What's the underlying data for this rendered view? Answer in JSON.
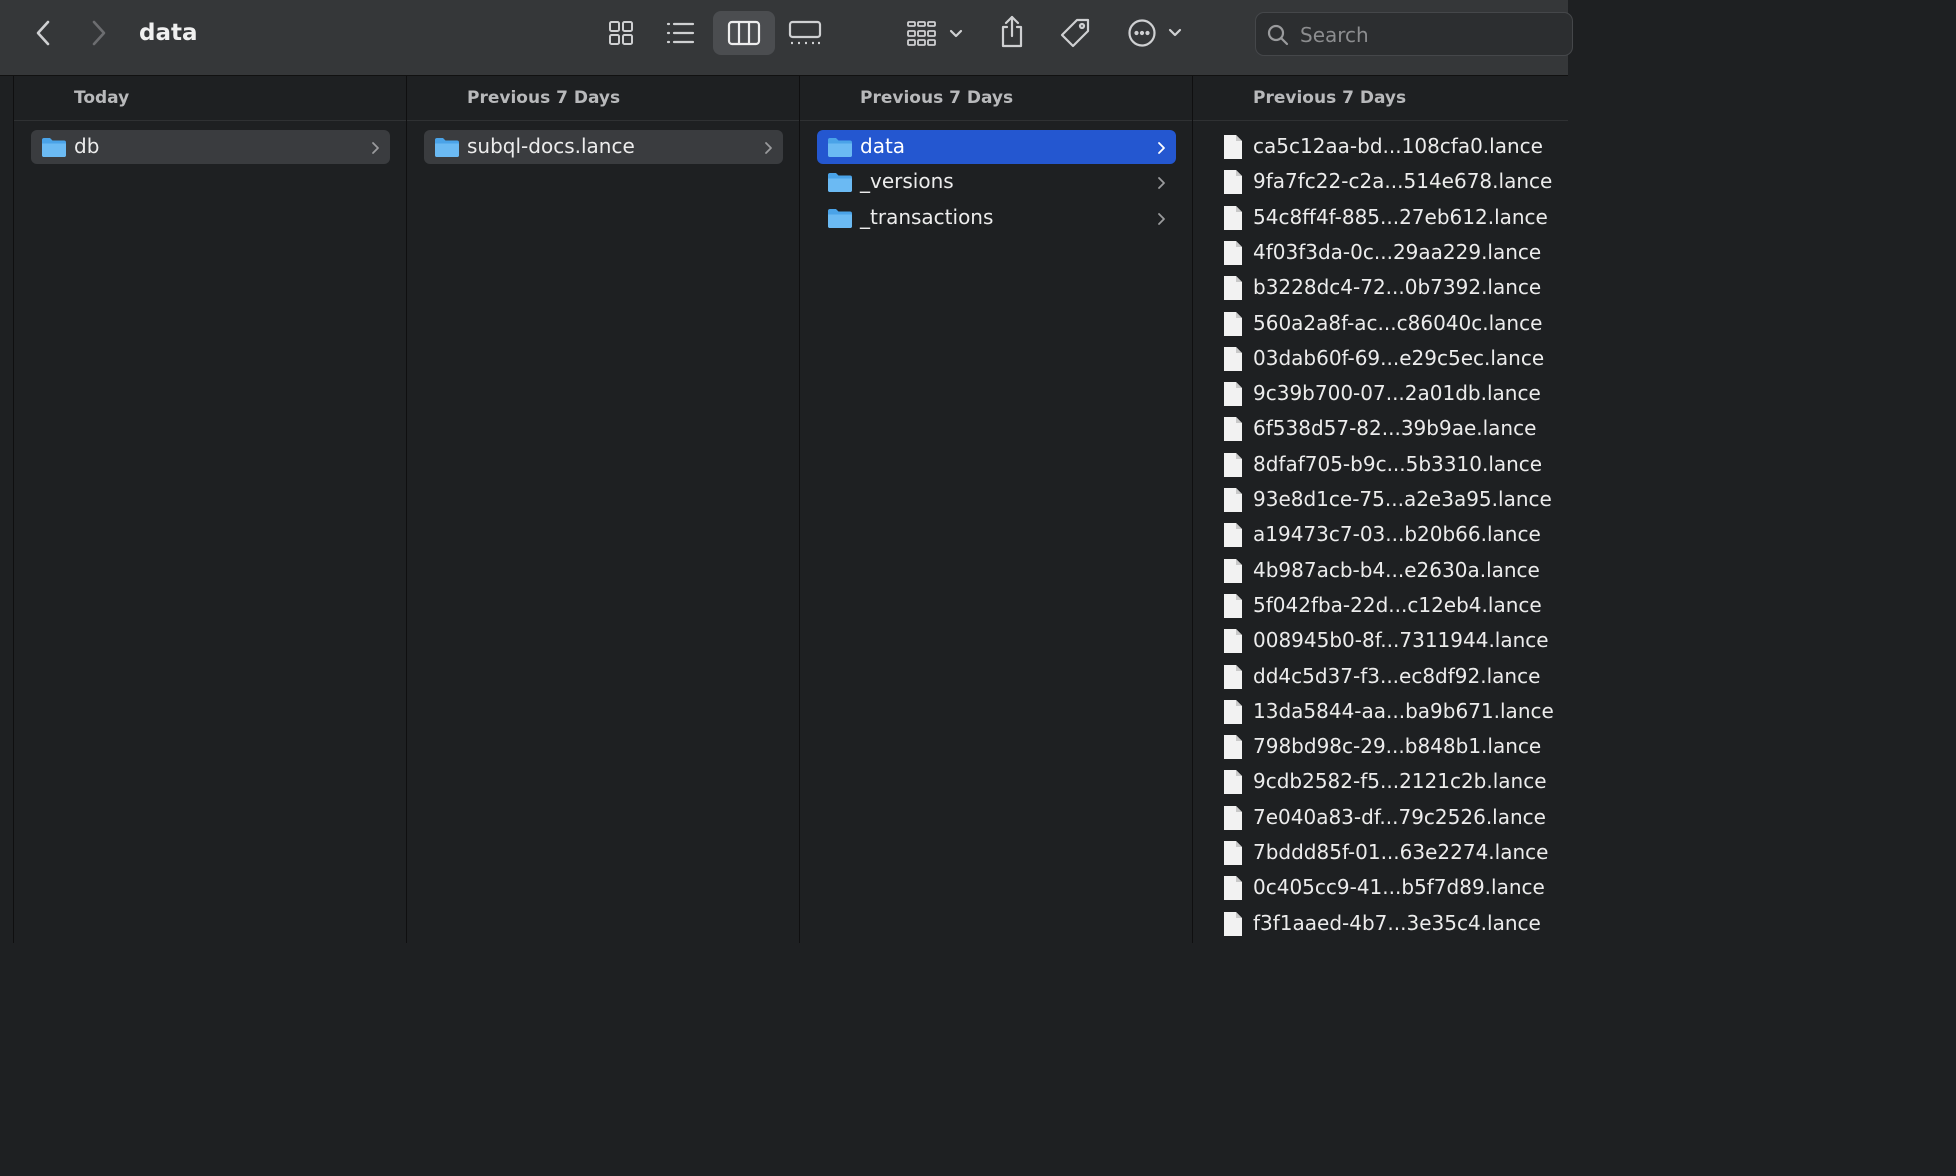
{
  "window": {
    "title": "data"
  },
  "search": {
    "placeholder": "Search"
  },
  "columns": [
    {
      "header": "Today",
      "items": [
        {
          "name": "db",
          "kind": "folder",
          "selected": "inactive"
        }
      ]
    },
    {
      "header": "Previous 7 Days",
      "items": [
        {
          "name": "subql-docs.lance",
          "kind": "folder",
          "selected": "inactive"
        }
      ]
    },
    {
      "header": "Previous 7 Days",
      "items": [
        {
          "name": "data",
          "kind": "folder",
          "selected": "active"
        },
        {
          "name": "_versions",
          "kind": "folder",
          "selected": "none"
        },
        {
          "name": "_transactions",
          "kind": "folder",
          "selected": "none"
        }
      ]
    },
    {
      "header": "Previous 7 Days",
      "items": [
        {
          "name": "ca5c12aa-bd...108cfa0.lance",
          "kind": "file"
        },
        {
          "name": "9fa7fc22-c2a...514e678.lance",
          "kind": "file"
        },
        {
          "name": "54c8ff4f-885...27eb612.lance",
          "kind": "file"
        },
        {
          "name": "4f03f3da-0c...29aa229.lance",
          "kind": "file"
        },
        {
          "name": "b3228dc4-72...0b7392.lance",
          "kind": "file"
        },
        {
          "name": "560a2a8f-ac...c86040c.lance",
          "kind": "file"
        },
        {
          "name": "03dab60f-69...e29c5ec.lance",
          "kind": "file"
        },
        {
          "name": "9c39b700-07...2a01db.lance",
          "kind": "file"
        },
        {
          "name": "6f538d57-82...39b9ae.lance",
          "kind": "file"
        },
        {
          "name": "8dfaf705-b9c...5b3310.lance",
          "kind": "file"
        },
        {
          "name": "93e8d1ce-75...a2e3a95.lance",
          "kind": "file"
        },
        {
          "name": "a19473c7-03...b20b66.lance",
          "kind": "file"
        },
        {
          "name": "4b987acb-b4...e2630a.lance",
          "kind": "file"
        },
        {
          "name": "5f042fba-22d...c12eb4.lance",
          "kind": "file"
        },
        {
          "name": "008945b0-8f...7311944.lance",
          "kind": "file"
        },
        {
          "name": "dd4c5d37-f3...ec8df92.lance",
          "kind": "file"
        },
        {
          "name": "13da5844-aa...ba9b671.lance",
          "kind": "file"
        },
        {
          "name": "798bd98c-29...b848b1.lance",
          "kind": "file"
        },
        {
          "name": "9cdb2582-f5...2121c2b.lance",
          "kind": "file"
        },
        {
          "name": "7e040a83-df...79c2526.lance",
          "kind": "file"
        },
        {
          "name": "7bddd85f-01...63e2274.lance",
          "kind": "file"
        },
        {
          "name": "0c405cc9-41...b5f7d89.lance",
          "kind": "file"
        },
        {
          "name": "f3f1aaed-4b7...3e35c4.lance",
          "kind": "file"
        }
      ]
    }
  ],
  "toolbar": {
    "back": "chevron-left-icon",
    "forward": "chevron-right-icon",
    "views": [
      "icon-view-icon",
      "list-view-icon",
      "column-view-icon",
      "gallery-view-icon"
    ],
    "active_view": "column-view-icon",
    "group": "group-by-icon",
    "share": "share-icon",
    "tag": "tag-icon",
    "more": "ellipsis-circle-icon"
  },
  "colors": {
    "toolbar_bg": "#353739",
    "pane_bg": "#1e2022",
    "selection_active": "#2457d0",
    "selection_inactive": "#3a3c3f",
    "folder": "#5fb0ee"
  }
}
